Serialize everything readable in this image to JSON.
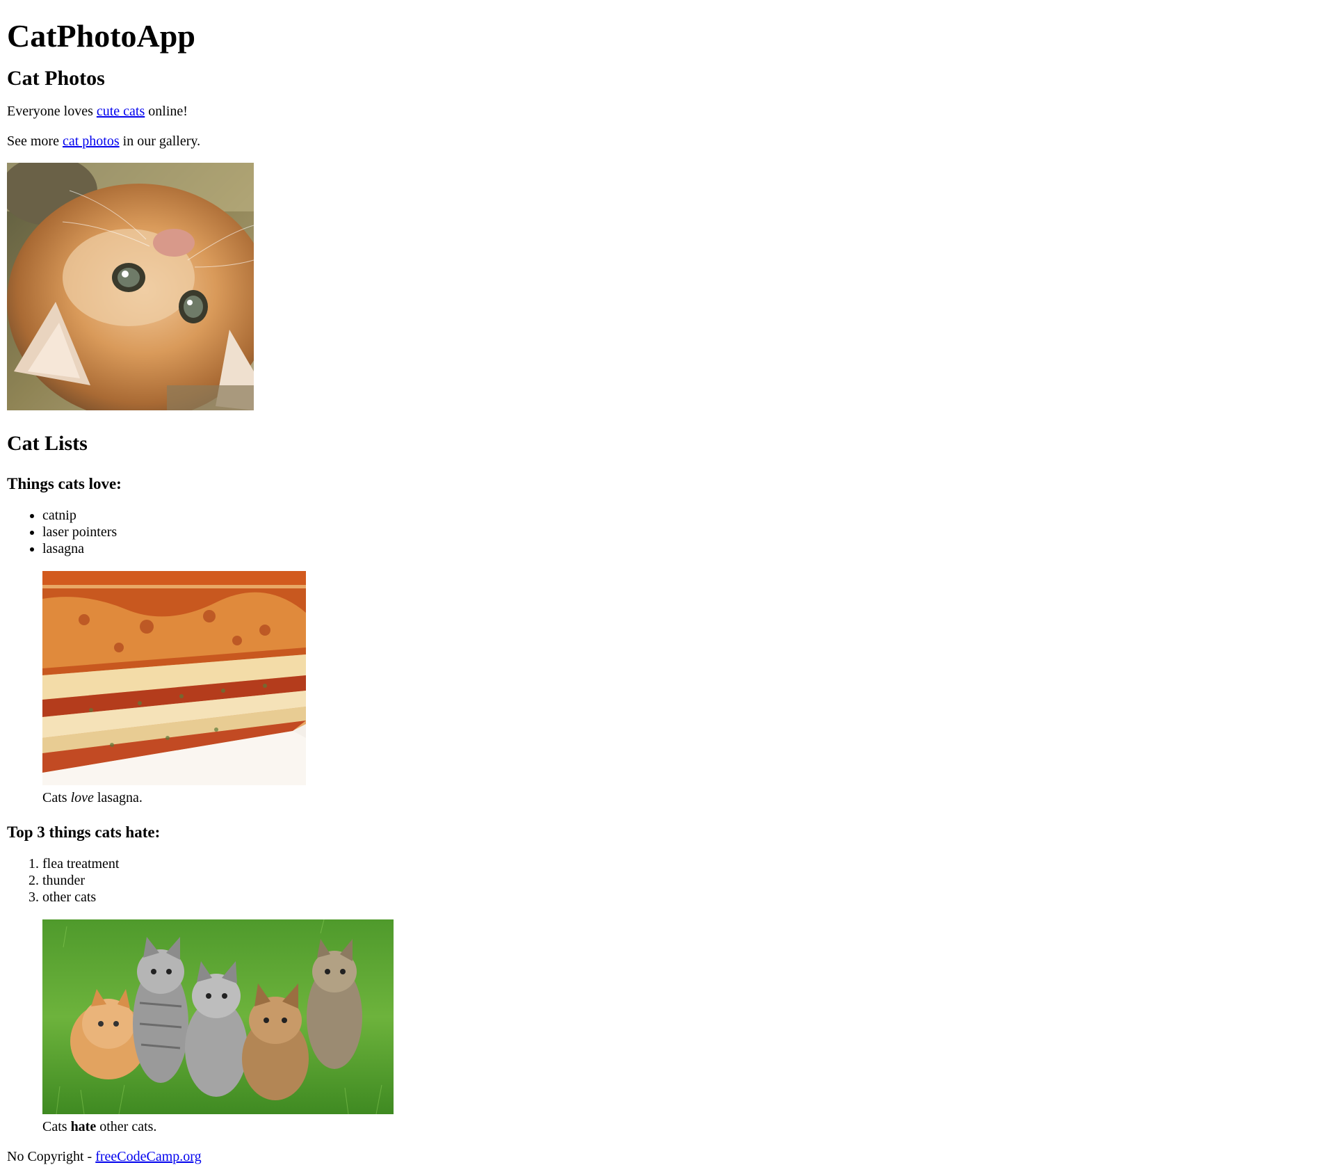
{
  "header": {
    "title": "CatPhotoApp"
  },
  "photos_section": {
    "heading": "Cat Photos",
    "intro": {
      "before": "Everyone loves ",
      "link": "cute cats",
      "after": " online!"
    },
    "more": {
      "before": "See more ",
      "link": "cat photos",
      "after": " in our gallery."
    }
  },
  "lists_section": {
    "heading": "Cat Lists",
    "love": {
      "heading": "Things cats love:",
      "items": [
        "catnip",
        "laser pointers",
        "lasagna"
      ],
      "caption": {
        "before": "Cats ",
        "emphasis": "love",
        "after": " lasagna."
      }
    },
    "hate": {
      "heading": "Top 3 things cats hate:",
      "items": [
        "flea treatment",
        "thunder",
        "other cats"
      ],
      "caption": {
        "before": "Cats ",
        "strong": "hate",
        "after": " other cats."
      }
    }
  },
  "footer": {
    "text": "No Copyright - ",
    "link": "freeCodeCamp.org"
  }
}
